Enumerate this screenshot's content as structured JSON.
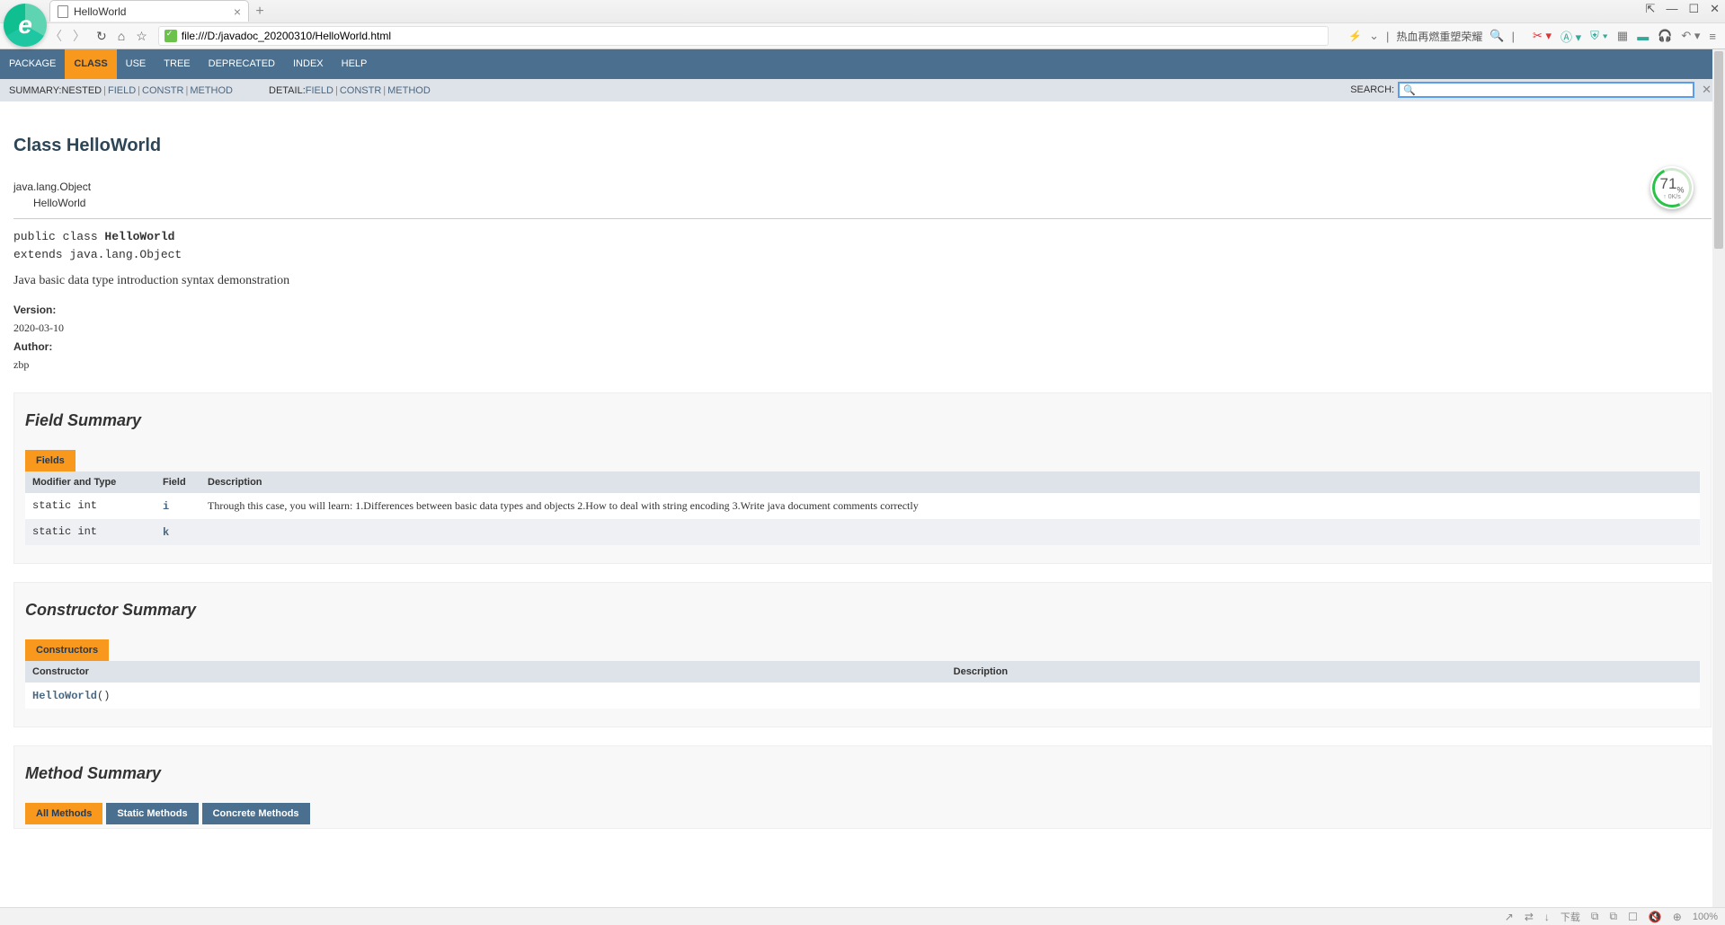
{
  "browser": {
    "tab_title": "HelloWorld",
    "url": "file:///D:/javadoc_20200310/HelloWorld.html",
    "addr_right_text": "热血再燃重塑荣耀"
  },
  "perf": {
    "percent": "71",
    "unit": "%",
    "rate": "↑ 0K/s"
  },
  "nav": {
    "items": [
      "PACKAGE",
      "CLASS",
      "USE",
      "TREE",
      "DEPRECATED",
      "INDEX",
      "HELP"
    ],
    "active_index": 1
  },
  "subnav": {
    "summary_label": "SUMMARY: ",
    "summary_nested": "NESTED",
    "summary_field": "FIELD",
    "summary_constr": "CONSTR",
    "summary_method": "METHOD",
    "detail_label": "DETAIL: ",
    "detail_field": "FIELD",
    "detail_constr": "CONSTR",
    "detail_method": "METHOD",
    "search_label": "SEARCH:",
    "search_value": ""
  },
  "class": {
    "title": "Class HelloWorld",
    "inheritance": {
      "parent": "java.lang.Object",
      "child": "HelloWorld"
    },
    "decl_prefix": "public class ",
    "decl_name": "HelloWorld",
    "decl_extends": "extends java.lang.Object",
    "description": "Java basic data type introduction syntax demonstration",
    "version_label": "Version:",
    "version_value": "2020-03-10",
    "author_label": "Author:",
    "author_value": "zbp"
  },
  "field_summary": {
    "title": "Field Summary",
    "caption": "Fields",
    "cols": [
      "Modifier and Type",
      "Field",
      "Description"
    ],
    "rows": [
      {
        "mod": "static int",
        "field": "i",
        "desc": "Through this case, you will learn: 1.Differences between basic data types and objects 2.How to deal with string encoding 3.Write java document comments correctly"
      },
      {
        "mod": "static int",
        "field": "k",
        "desc": ""
      }
    ]
  },
  "constructor_summary": {
    "title": "Constructor Summary",
    "caption": "Constructors",
    "cols": [
      "Constructor",
      "Description"
    ],
    "rows": [
      {
        "ctor": "HelloWorld",
        "args": "()",
        "desc": ""
      }
    ]
  },
  "method_summary": {
    "title": "Method Summary",
    "tabs": [
      "All Methods",
      "Static Methods",
      "Concrete Methods"
    ],
    "active_tab": 0
  },
  "status": {
    "download": "下载",
    "zoom": "100%"
  }
}
